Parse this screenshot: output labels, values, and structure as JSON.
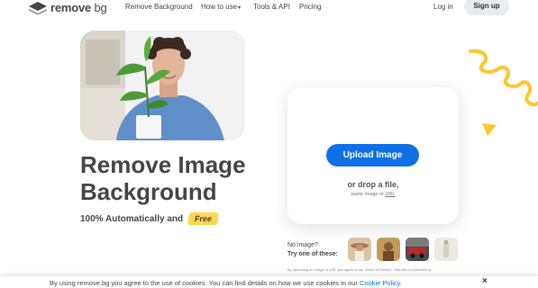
{
  "header": {
    "logo_bold": "remove",
    "logo_light": "bg",
    "nav": [
      {
        "label": "Remove Background"
      },
      {
        "label": "How to use"
      },
      {
        "label": "Tools & API"
      },
      {
        "label": "Pricing"
      }
    ],
    "login": "Log in",
    "signup": "Sign up"
  },
  "hero": {
    "headline": "Remove Image\nBackground",
    "subtitle": "100% Automatically and",
    "badge": "Free"
  },
  "upload": {
    "button": "Upload Image",
    "drop_text": "or drop a file,",
    "paste_text": "paste image or",
    "paste_link": "URL"
  },
  "samples": {
    "line1": "No image?",
    "line2": "Try one of these:"
  },
  "terms": "By uploading an image or URL you agree to our Terms of Service. This site is protected by",
  "cookie": {
    "text": "By using remove.bg you agree to the use of cookies. You can find details on how we use cookies in our",
    "link": "Cookie Policy.",
    "close": "×"
  },
  "colors": {
    "accent": "#0f70e6",
    "badge": "#ffd84d",
    "decoration": "#ffc62e"
  }
}
